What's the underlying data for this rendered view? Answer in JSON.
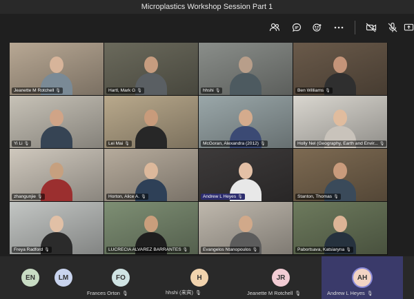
{
  "window": {
    "title": "Microplastics Workshop Session Part 1"
  },
  "toolbar": {
    "icons": [
      "people-icon",
      "chat-icon",
      "reactions-icon",
      "more-icon",
      "camera-off-icon",
      "mic-off-icon",
      "share-icon"
    ]
  },
  "tiles": [
    {
      "name": "Jeanette M Rotchell",
      "bg": "#b8a894",
      "skin": "#d7b49a",
      "shirt": "#7a8a96"
    },
    {
      "name": "Hartl, Mark G",
      "bg": "#6b6a5c",
      "skin": "#c69c7f",
      "shirt": "#5a5f63"
    },
    {
      "name": "hhshi",
      "bg": "#8a8e8a",
      "skin": "#b89e8a",
      "shirt": "#4d5a60"
    },
    {
      "name": "Ben Williams",
      "bg": "#6a5a4a",
      "skin": "#c49479",
      "shirt": "#2f2f2f"
    },
    {
      "name": "Yi Li",
      "bg": "#c7c2b7",
      "skin": "#d0a487",
      "shirt": "#364454"
    },
    {
      "name": "Lei Mai",
      "bg": "#b9a98c",
      "skin": "#c89b7b",
      "shirt": "#272727"
    },
    {
      "name": "McGoran, Alexandra (2012)",
      "bg": "#9aa7a9",
      "skin": "#d4ab8d",
      "shirt": "#3b4a74"
    },
    {
      "name": "Holly Nel (Geography, Earth and Envir...",
      "bg": "#d9d6cf",
      "skin": "#e0bc9e",
      "shirt": "#c9c3bb"
    },
    {
      "name": "zhangunjie",
      "bg": "#cfc8bd",
      "skin": "#c6a07f",
      "shirt": "#9b2f2f"
    },
    {
      "name": "Horton, Alice A.",
      "bg": "#b6ab9c",
      "skin": "#dcb89b",
      "shirt": "#2e4057"
    },
    {
      "name": "Andrew L Heyes",
      "bg": "#3d3a3a",
      "skin": "#e3c0a6",
      "shirt": "#e8e8e8",
      "active": true
    },
    {
      "name": "Stanton, Thomas",
      "bg": "#7d6a52",
      "skin": "#c99b7c",
      "shirt": "#3a4a5a"
    },
    {
      "name": "Freya Radford",
      "bg": "#c3c6c4",
      "skin": "#e1c0a6",
      "shirt": "#2b2b2b"
    },
    {
      "name": "LUCRECIA ALVAREZ BARRANTES",
      "bg": "#7e8f74",
      "skin": "#c99e7c",
      "shirt": "#1e1e1e"
    },
    {
      "name": "Evangelos Ntanopoulos",
      "bg": "#bfb8ad",
      "skin": "#d1a98a",
      "shirt": "#5c5c5c"
    },
    {
      "name": "Pabortsava, Katsiaryna",
      "bg": "#6d7a5d",
      "skin": "#dcb496",
      "shirt": "#26323e"
    }
  ],
  "bottom_bar": [
    {
      "initials": "EN",
      "name": "",
      "color": "#c8dcc4"
    },
    {
      "initials": "LM",
      "name": "",
      "color": "#c9d4ee"
    },
    {
      "initials": "FO",
      "name": "Frances Orton",
      "color": "#cfe3e3"
    },
    {
      "initials": "H",
      "name": "hhshi (来宾)",
      "color": "#f1d3ad"
    },
    {
      "initials": "JR",
      "name": "Jeanette M Rotchell",
      "color": "#f2ccd4"
    },
    {
      "initials": "AH",
      "name": "Andrew L Heyes",
      "color": "#f3d4c4",
      "speaking": true
    }
  ]
}
